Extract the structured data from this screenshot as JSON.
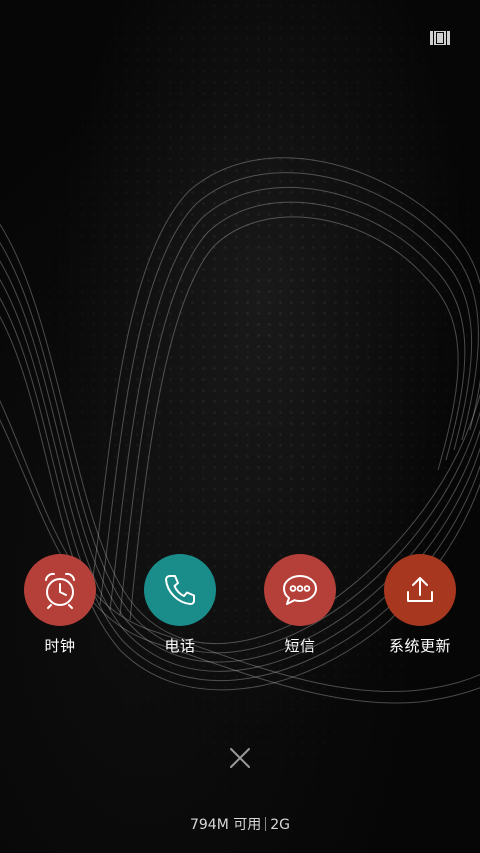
{
  "apps": [
    {
      "label": "时钟",
      "icon": "alarm-clock-icon",
      "color": "#b5403a"
    },
    {
      "label": "电话",
      "icon": "phone-icon",
      "color": "#1a8c8a"
    },
    {
      "label": "短信",
      "icon": "message-icon",
      "color": "#b5403a"
    },
    {
      "label": "系统更新",
      "icon": "upload-icon",
      "color": "#a8371f"
    }
  ],
  "status": {
    "available_memory": "794M 可用",
    "network": "2G"
  },
  "icons": {
    "top_right": "recent-apps-toggle-icon",
    "close": "close-icon"
  }
}
